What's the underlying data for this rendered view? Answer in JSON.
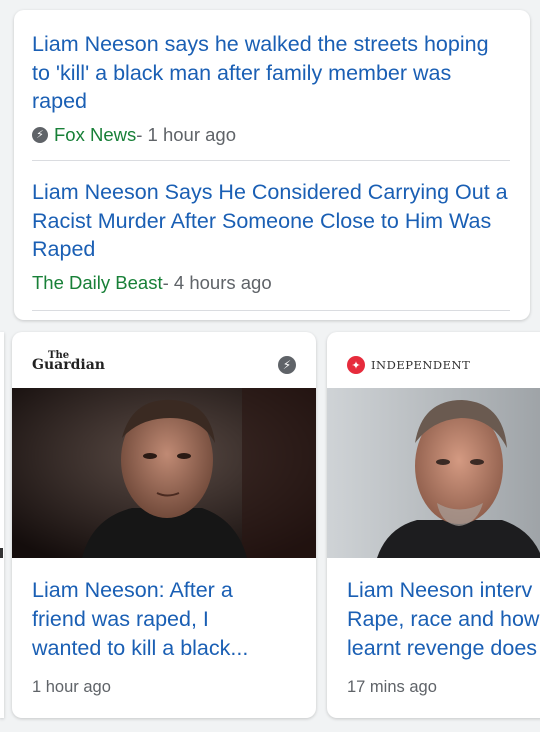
{
  "stories": [
    {
      "headline": "Liam Neeson says he walked the streets hoping to 'kill' a black man after family member was raped",
      "source": "Fox News",
      "time": " - 1 hour ago",
      "amp": true
    },
    {
      "headline": "Liam Neeson Says He Considered Carrying Out a Racist Murder After Someone Close to Him Was Raped",
      "source": "The Daily Beast",
      "time": " - 4 hours ago",
      "amp": false
    }
  ],
  "carousel": [
    {
      "publisher_line1": "The",
      "publisher_line2": "Guardian",
      "title": "Liam Neeson: After a\nfriend was raped, I\nwanted to kill a black...",
      "time": "1 hour ago"
    },
    {
      "publisher": "INDEPENDENT",
      "title": "Liam Neeson interv\nRape, race and how\nlearnt revenge does",
      "time": "17 mins ago"
    }
  ],
  "icons": {
    "amp": "lightning-bolt",
    "independent": "eagle"
  },
  "colors": {
    "headline": "#1a5fb4",
    "source": "#188038",
    "meta": "#5f6368"
  }
}
